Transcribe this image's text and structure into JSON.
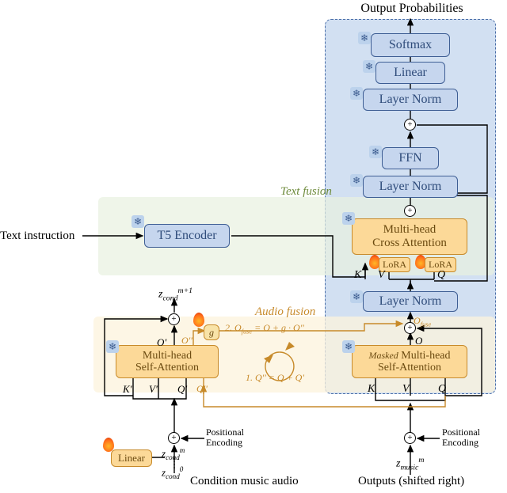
{
  "top_label": "Output Probabilities",
  "stack": {
    "softmax": "Softmax",
    "linear": "Linear",
    "layernorm_top": "Layer Norm",
    "ffn": "FFN",
    "layernorm_mid": "Layer Norm",
    "cross_attn": "Multi-head\nCross Attention",
    "layernorm_low": "Layer Norm",
    "masked_self_attn": "Masked Multi-head\nSelf-Attention"
  },
  "text_fusion": {
    "section_label": "Text fusion",
    "t5": "T5 Encoder",
    "input_label": "Text instruction",
    "lora1": "LoRA",
    "lora2": "LoRA",
    "kvq": {
      "k": "K",
      "v": "V",
      "q": "Q"
    }
  },
  "audio_fusion": {
    "section_label": "Audio fusion",
    "left_attn": "Multi-head\nSelf-Attention",
    "left_kvq": {
      "k": "K'",
      "v": "V'",
      "q": "Q'"
    },
    "right_kvq": {
      "k": "K",
      "v": "V",
      "q": "Q"
    },
    "g_label": "g",
    "eq1": "1. Q'' = Q + Q'",
    "eq2": "2. O_fuse = O + g · O''",
    "o_left": "O'",
    "o_pp": "O''",
    "o_right": "O",
    "o_fuse": "O_fuse",
    "q_pp": "Q''"
  },
  "bottom": {
    "linear": "Linear",
    "z_cond_m": "z_{cond}^{m}",
    "z_cond_0": "z_{cond}^{0}",
    "z_cond_mp1": "z_{cond}^{m+1}",
    "z_music_m": "z_{music}^{m}",
    "pos_enc_left": "Positional\nEncoding",
    "pos_enc_right": "Positional\nEncoding",
    "cond_label": "Condition music audio",
    "out_label": "Outputs (shifted right)"
  }
}
